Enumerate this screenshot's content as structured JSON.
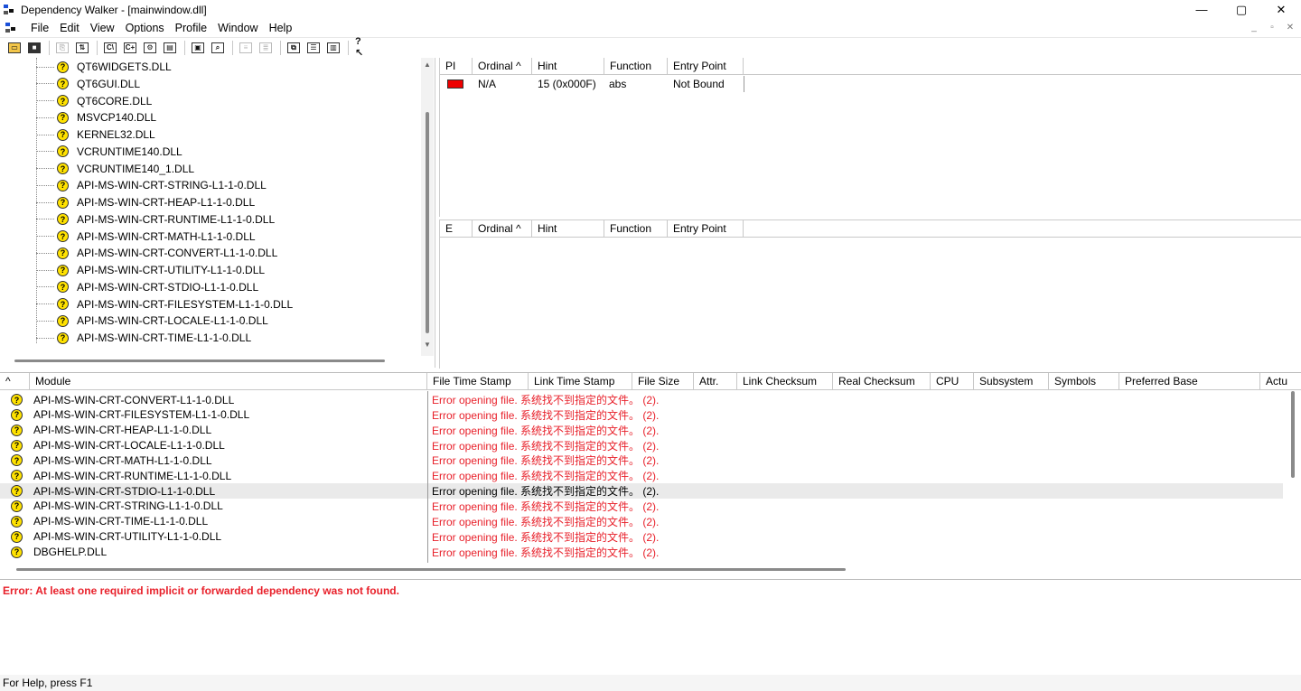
{
  "window": {
    "title": "Dependency Walker - [mainwindow.dll]",
    "controls": [
      "—",
      "▢",
      "✕"
    ]
  },
  "menu": {
    "items": [
      "File",
      "Edit",
      "View",
      "Options",
      "Profile",
      "Window",
      "Help"
    ],
    "mdi_controls": [
      "_",
      "▫",
      "✕"
    ]
  },
  "tree": {
    "items": [
      "QT6WIDGETS.DLL",
      "QT6GUI.DLL",
      "QT6CORE.DLL",
      "MSVCP140.DLL",
      "KERNEL32.DLL",
      "VCRUNTIME140.DLL",
      "VCRUNTIME140_1.DLL",
      "API-MS-WIN-CRT-STRING-L1-1-0.DLL",
      "API-MS-WIN-CRT-HEAP-L1-1-0.DLL",
      "API-MS-WIN-CRT-RUNTIME-L1-1-0.DLL",
      "API-MS-WIN-CRT-MATH-L1-1-0.DLL",
      "API-MS-WIN-CRT-CONVERT-L1-1-0.DLL",
      "API-MS-WIN-CRT-UTILITY-L1-1-0.DLL",
      "API-MS-WIN-CRT-STDIO-L1-1-0.DLL",
      "API-MS-WIN-CRT-FILESYSTEM-L1-1-0.DLL",
      "API-MS-WIN-CRT-LOCALE-L1-1-0.DLL",
      "API-MS-WIN-CRT-TIME-L1-1-0.DLL"
    ]
  },
  "imports": {
    "headers": [
      "PI",
      "Ordinal ^",
      "Hint",
      "Function",
      "Entry Point"
    ],
    "row": {
      "ordinal": "N/A",
      "hint": "15 (0x000F)",
      "function": "abs",
      "entry_point": "Not Bound"
    }
  },
  "exports": {
    "headers": [
      "E",
      "Ordinal ^",
      "Hint",
      "Function",
      "Entry Point"
    ]
  },
  "modules": {
    "headers": [
      "^",
      "Module",
      "File Time Stamp",
      "Link Time Stamp",
      "File Size",
      "Attr.",
      "Link Checksum",
      "Real Checksum",
      "CPU",
      "Subsystem",
      "Symbols",
      "Preferred Base",
      "Actu"
    ],
    "error_text": "Error opening file. 系统找不到指定的文件。 (2).",
    "rows": [
      "API-MS-WIN-CRT-CONVERT-L1-1-0.DLL",
      "API-MS-WIN-CRT-FILESYSTEM-L1-1-0.DLL",
      "API-MS-WIN-CRT-HEAP-L1-1-0.DLL",
      "API-MS-WIN-CRT-LOCALE-L1-1-0.DLL",
      "API-MS-WIN-CRT-MATH-L1-1-0.DLL",
      "API-MS-WIN-CRT-RUNTIME-L1-1-0.DLL",
      "API-MS-WIN-CRT-STDIO-L1-1-0.DLL",
      "API-MS-WIN-CRT-STRING-L1-1-0.DLL",
      "API-MS-WIN-CRT-TIME-L1-1-0.DLL",
      "API-MS-WIN-CRT-UTILITY-L1-1-0.DLL",
      "DBGHELP.DLL"
    ],
    "selected_index": 6
  },
  "log": {
    "message": "Error: At least one required implicit or forwarded dependency was not found."
  },
  "status": {
    "text": "For Help, press F1"
  },
  "colors": {
    "error": "#e8202a",
    "missing_icon": "#ffe200",
    "selected_row": "#eaeaea"
  }
}
